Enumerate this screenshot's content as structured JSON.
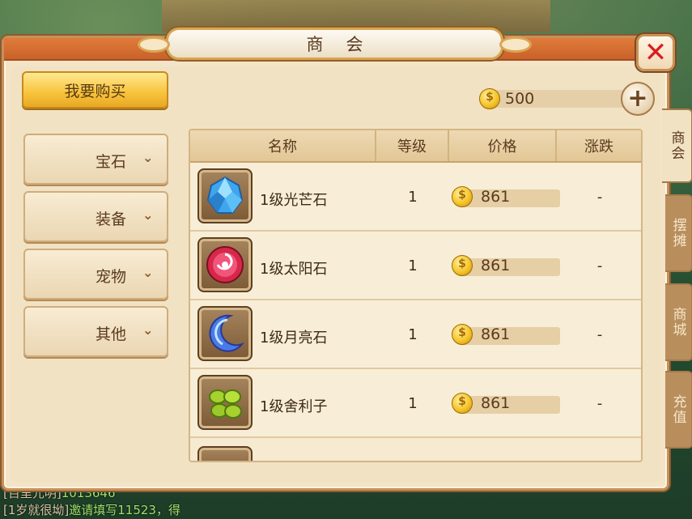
{
  "window": {
    "title": "商会",
    "close_label": "✕"
  },
  "toolbar": {
    "buy_label": "我要购买",
    "money": "500",
    "add_label": "+"
  },
  "categories": [
    {
      "label": "宝石",
      "icon": "chevron-down-icon"
    },
    {
      "label": "装备",
      "icon": "chevron-down-icon"
    },
    {
      "label": "宠物",
      "icon": "chevron-down-icon"
    },
    {
      "label": "其他",
      "icon": "chevron-down-icon"
    }
  ],
  "side_tabs": [
    {
      "label": "商会",
      "active": true
    },
    {
      "label": "摆摊",
      "active": false
    },
    {
      "label": "商城",
      "active": false
    },
    {
      "label": "充值",
      "active": false
    }
  ],
  "table": {
    "headers": [
      "名称",
      "等级",
      "价格",
      "涨跌"
    ],
    "rows": [
      {
        "icon": "blue-crystal-gem-icon",
        "name": "1级光芒石",
        "level": "1",
        "price": "861",
        "change": "-"
      },
      {
        "icon": "red-sun-gem-icon",
        "name": "1级太阳石",
        "level": "1",
        "price": "861",
        "change": "-"
      },
      {
        "icon": "blue-moon-gem-icon",
        "name": "1级月亮石",
        "level": "1",
        "price": "861",
        "change": "-"
      },
      {
        "icon": "green-relic-gem-icon",
        "name": "1级舍利子",
        "level": "1",
        "price": "861",
        "change": "-"
      }
    ]
  },
  "chat": [
    {
      "channel": "[百里元明]",
      "text": "1013646"
    },
    {
      "channel": "[1岁就很坳]",
      "text": "邀请填写11523，得"
    }
  ],
  "colors": {
    "frame_orange": "#d86d31",
    "panel_bg": "#f1e2c3",
    "gold": "#f7c33b"
  }
}
